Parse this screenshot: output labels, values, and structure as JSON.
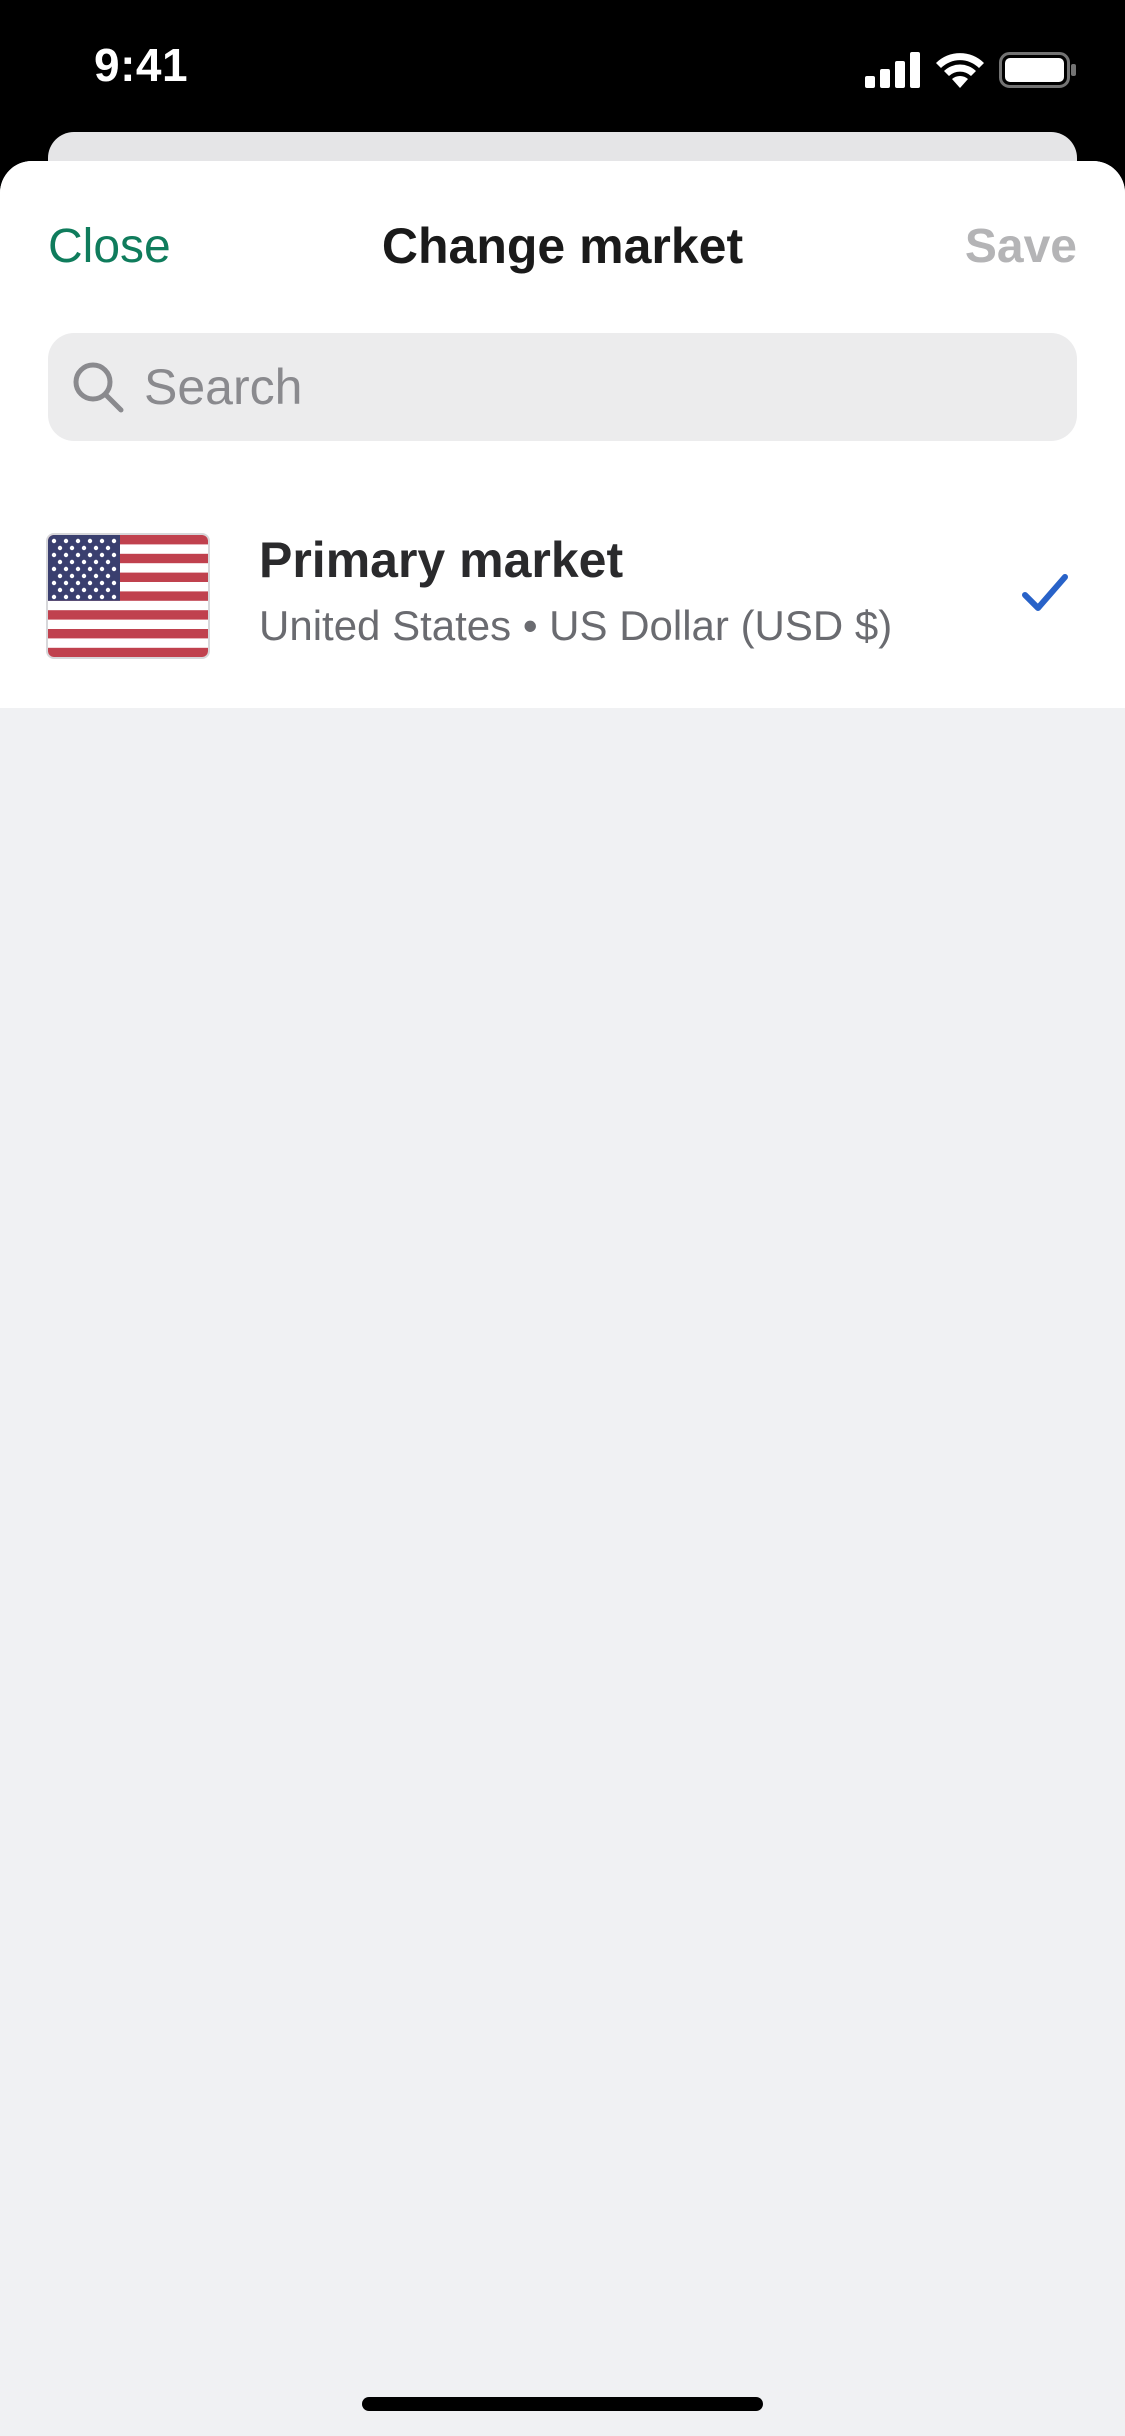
{
  "status_bar": {
    "time": "9:41",
    "icons": [
      "cellular-signal-icon",
      "wifi-icon",
      "battery-icon"
    ]
  },
  "nav": {
    "close_label": "Close",
    "title": "Change market",
    "save_label": "Save"
  },
  "search": {
    "placeholder": "Search",
    "value": "",
    "icon": "search-icon"
  },
  "markets": [
    {
      "flag_icon": "us-flag-icon",
      "title": "Primary market",
      "subtitle": "United States • US Dollar (USD $)",
      "selected": true,
      "selected_icon": "checkmark-icon"
    }
  ],
  "colors": {
    "accent_green": "#0f7c5c",
    "check_blue": "#2862c8",
    "disabled_gray": "#b4b4b6",
    "background_gray": "#f0f1f3"
  }
}
